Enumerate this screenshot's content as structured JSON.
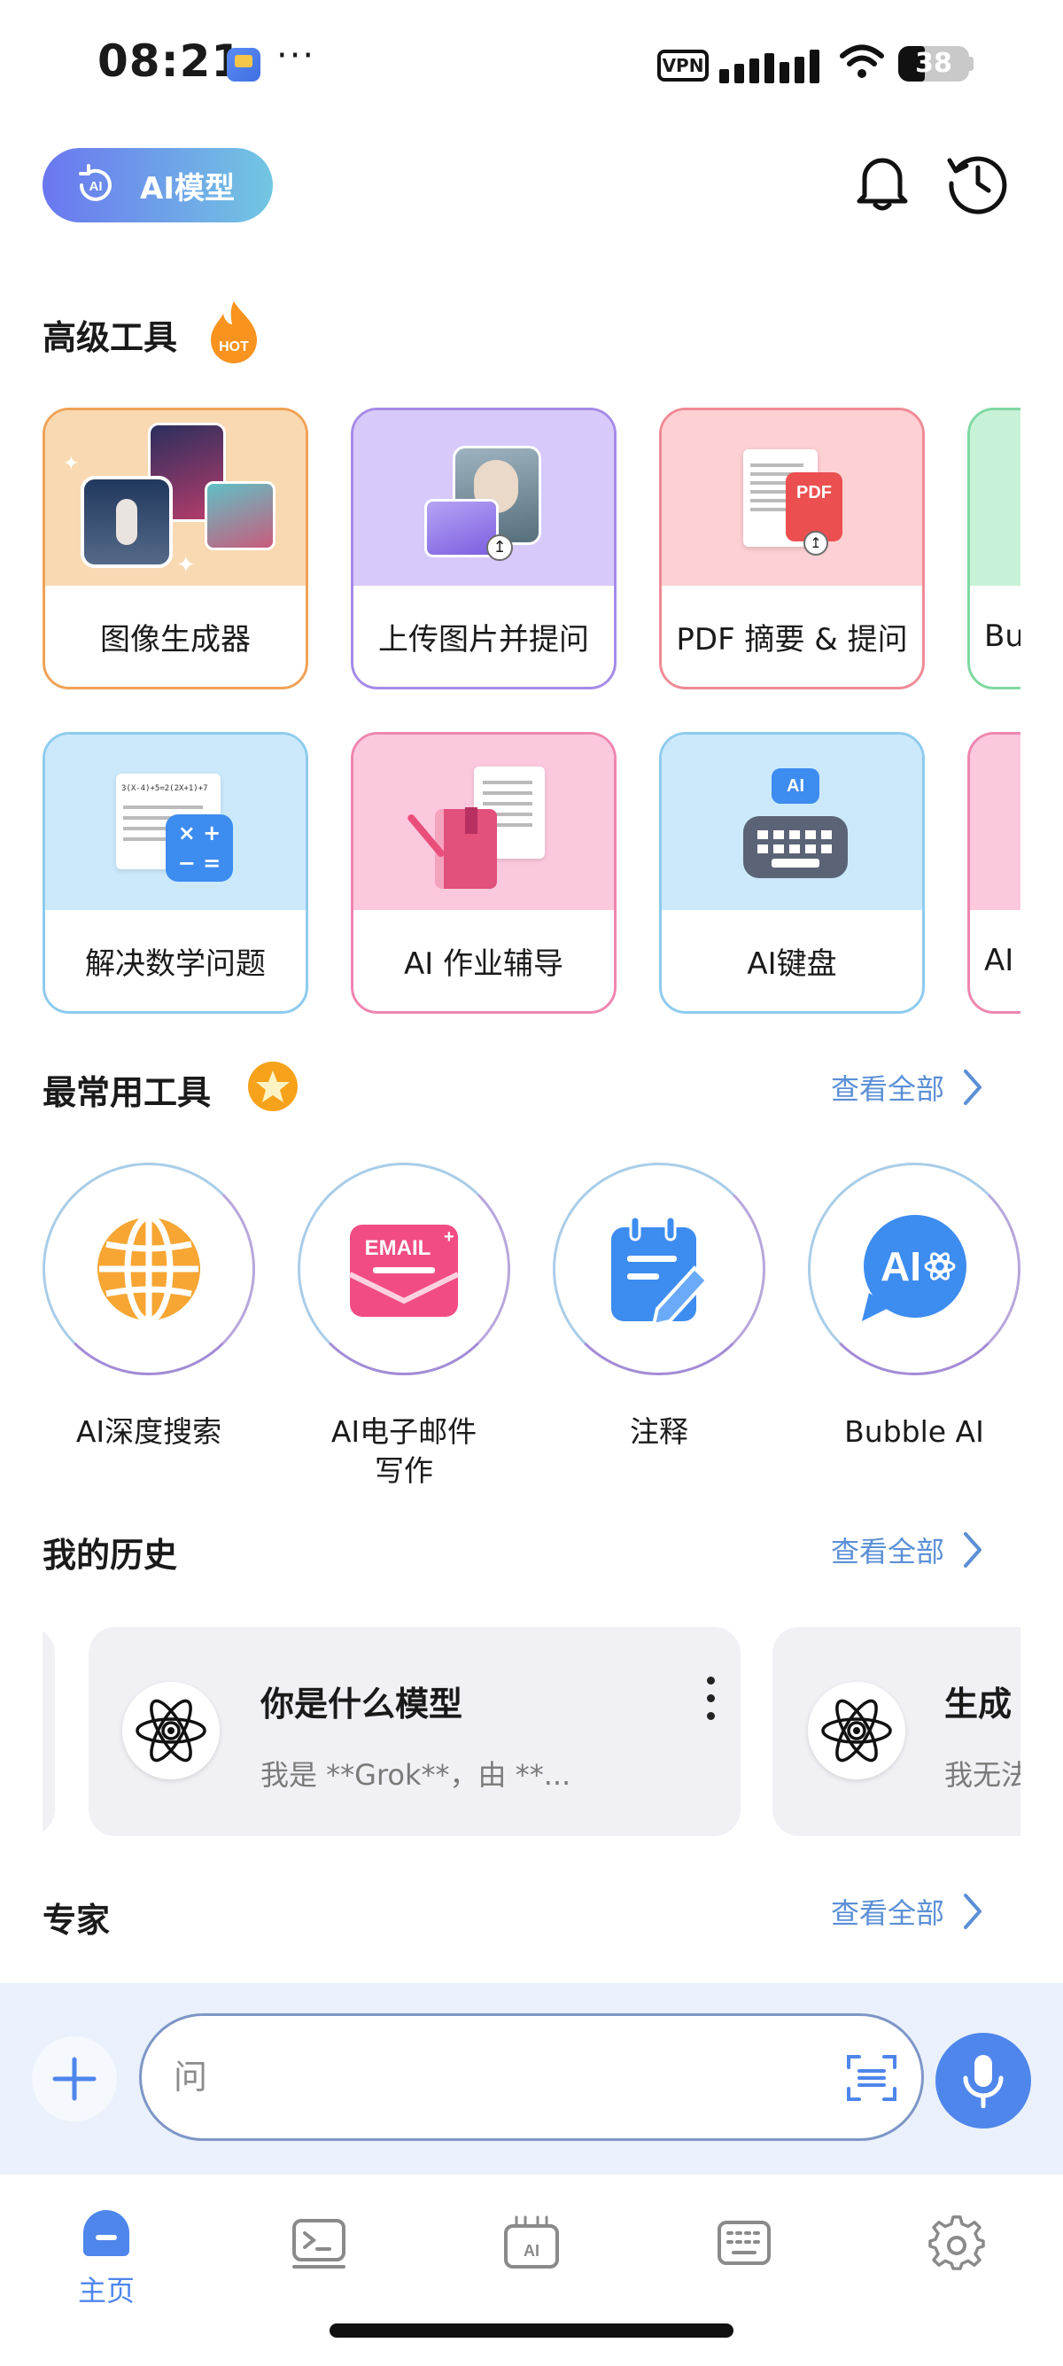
{
  "status": {
    "time": "08:21",
    "dots": "···",
    "vpn": "VPN",
    "battery": "38",
    "battery_level": 0.38
  },
  "header": {
    "model_label": "AI模型",
    "model_icon_text": "AI",
    "icons": [
      "bell-icon",
      "history-clock-icon"
    ]
  },
  "advanced_tools": {
    "title": "高级工具",
    "badge": "HOT",
    "row1": [
      {
        "label": "图像生成器",
        "color": "#f0a256",
        "bg": "#f9d9b2"
      },
      {
        "label": "上传图片并提问",
        "color": "#a58be6",
        "bg": "#d7c9fa"
      },
      {
        "label": "PDF 摘要 & 提问",
        "color": "#f08a96",
        "bg": "#fdd0d3"
      },
      {
        "label": "Bu",
        "color": "#7fd8a2",
        "bg": "#c8f2d7"
      }
    ],
    "row2": [
      {
        "label": "解决数学问题",
        "color": "#8ecbee",
        "bg": "#cbe9fb"
      },
      {
        "label": "AI 作业辅导",
        "color": "#ee86b0",
        "bg": "#fcc8dd"
      },
      {
        "label": "AI键盘",
        "color": "#8ecbee",
        "bg": "#cbe9fb"
      },
      {
        "label": "AI",
        "color": "#ee86b0",
        "bg": "#fcc8dd"
      }
    ],
    "pdf_icon_text": "PDF",
    "ai_chip_text": "AI",
    "math_formula_text": "3(X-4)+5=2(2X+1)+7"
  },
  "frequent_tools": {
    "title": "最常用工具",
    "see_all": "查看全部",
    "items": [
      {
        "label": "AI深度搜索"
      },
      {
        "label": "AI电子邮件写作"
      },
      {
        "label": "注释"
      },
      {
        "label": "Bubble AI"
      }
    ],
    "email_icon_text": "EMAIL",
    "bubble_icon_text": "AI"
  },
  "history": {
    "title": "我的历史",
    "see_all": "查看全部",
    "items": [
      {
        "title": "你是什么模型",
        "subtitle": "我是 **Grok**，由 **..."
      },
      {
        "title": "生成",
        "subtitle": "我无法"
      }
    ]
  },
  "experts": {
    "title": "专家",
    "see_all": "查看全部"
  },
  "input": {
    "placeholder": "问",
    "value": ""
  },
  "tabs": [
    {
      "label": "主页",
      "icon": "home-icon",
      "active": true
    },
    {
      "label": "",
      "icon": "terminal-icon",
      "active": false
    },
    {
      "label": "",
      "icon": "ai-keyboard-icon",
      "active": false
    },
    {
      "label": "",
      "icon": "keyboard-icon",
      "active": false
    },
    {
      "label": "",
      "icon": "gear-icon",
      "active": false
    }
  ],
  "colors": {
    "accent": "#4f86ec",
    "link": "#5b8fd6",
    "input_bar_bg": "#eaf1fc"
  }
}
